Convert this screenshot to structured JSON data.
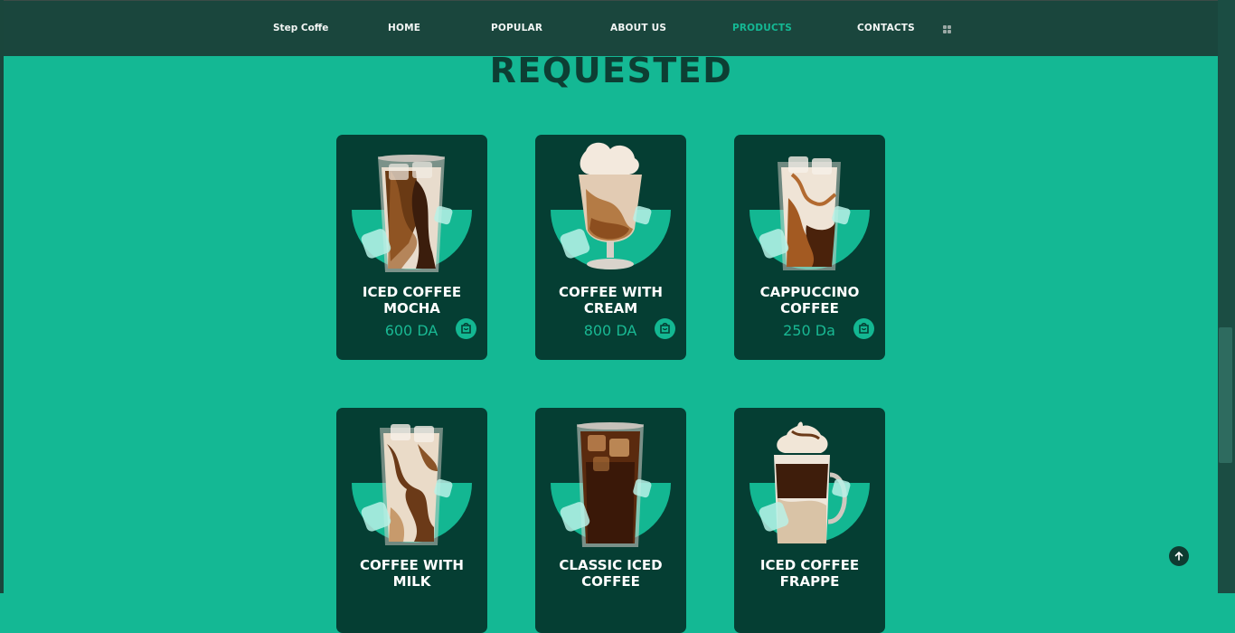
{
  "nav": {
    "brand": "Step Coffe",
    "items": [
      {
        "label": "HOME"
      },
      {
        "label": "POPULAR"
      },
      {
        "label": "ABOUT US"
      },
      {
        "label": "PRODUCTS",
        "active": true
      },
      {
        "label": "CONTACTS"
      }
    ],
    "menu_icon": "grid-icon"
  },
  "section": {
    "title": "REQUESTED"
  },
  "products": [
    {
      "name": "ICED COFFEE MOCHA",
      "line1": "ICED COFFEE",
      "line2": "MOCHA",
      "price": "600 DA",
      "icon": "cart-bag-icon"
    },
    {
      "name": "COFFEE WITH CREAM",
      "line1": "COFFEE WITH",
      "line2": "CREAM",
      "price": "800 DA",
      "icon": "cart-bag-icon"
    },
    {
      "name": "CAPPUCCINO COFFEE",
      "line1": "CAPPUCCINO",
      "line2": "COFFEE",
      "price": "250 Da",
      "icon": "cart-bag-icon"
    },
    {
      "name": "COFFEE WITH MILK",
      "line1": "COFFEE WITH",
      "line2": "MILK",
      "price": "",
      "icon": "cart-bag-icon"
    },
    {
      "name": "CLASSIC ICED COFFEE",
      "line1": "CLASSIC ICED",
      "line2": "COFFEE",
      "price": "",
      "icon": "cart-bag-icon"
    },
    {
      "name": "ICED COFFEE FRAPPE",
      "line1": "ICED COFFEE",
      "line2": "FRAPPE",
      "price": "",
      "icon": "cart-bag-icon"
    }
  ],
  "colors": {
    "background": "#14b894",
    "header": "#1a463d",
    "card": "#053e33",
    "accent": "#13b792",
    "title": "#0d3e33"
  },
  "scroll_top_icon": "arrow-up-icon"
}
